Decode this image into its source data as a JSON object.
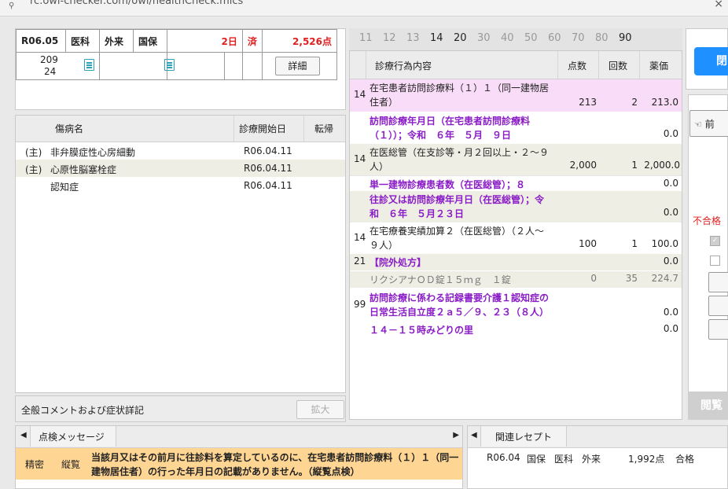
{
  "browser": {
    "url": "rc.owl-checker.com/owl/healthCheck.mics"
  },
  "header": {
    "era_month": "R06.05",
    "dept": "医科",
    "visit_type": "外来",
    "insurance": "国保",
    "days": "2日",
    "status": "済",
    "points": "2,526点",
    "code_top": "209",
    "code_bottom": "24",
    "detail_button": "詳細"
  },
  "disease": {
    "col_name": "傷病名",
    "col_start": "診療開始日",
    "col_outcome": "転帰",
    "rows": [
      {
        "mark": "(主)",
        "name": "非弁膜症性心房細動",
        "start": "R06.04.11"
      },
      {
        "mark": "(主)",
        "name": "心原性脳塞栓症",
        "start": "R06.04.11"
      },
      {
        "mark": "",
        "name": "認知症",
        "start": "R06.04.11"
      }
    ]
  },
  "comment": {
    "label": "全般コメントおよび症状詳記",
    "expand_button": "拡大"
  },
  "day_strip": [
    "11",
    "12",
    "13",
    "14",
    "20",
    "30",
    "40",
    "50",
    "60",
    "70",
    "80",
    "90"
  ],
  "treatment": {
    "col_content": "診療行為内容",
    "col_points": "点数",
    "col_count": "回数",
    "col_price": "薬価",
    "rows": [
      {
        "code": "14",
        "line1": "在宅患者訪問診療料（１）１（同一建物居",
        "line2": "住者）",
        "points": "213",
        "count": "2",
        "price": "213.0"
      },
      {
        "code": "",
        "line1": "訪問診療年月日（在宅患者訪問診療料",
        "line2": "（１））；令和　６年　５月　９日",
        "points": "",
        "count": "",
        "price": "0.0"
      },
      {
        "code": "14",
        "line1": "在医総管（在支診等・月２回以上・２～９",
        "line2": "人）",
        "points": "2,000",
        "count": "1",
        "price": "2,000.0"
      },
      {
        "code": "",
        "line1": "単一建物診療患者数（在医総管）；８",
        "line2": "",
        "points": "",
        "count": "",
        "price": "0.0"
      },
      {
        "code": "",
        "line1": "往診又は訪問診療年月日（在医総管）；令",
        "line2": "和　６年　５月２３日",
        "points": "",
        "count": "",
        "price": "0.0"
      },
      {
        "code": "14",
        "line1": "在宅療養実績加算２（在医総管）（２人～",
        "line2": "９人）",
        "points": "100",
        "count": "1",
        "price": "100.0"
      },
      {
        "code": "21",
        "line1": "【院外処方】",
        "line2": "",
        "points": "",
        "count": "",
        "price": "0.0"
      },
      {
        "code": "",
        "line1": "リクシアナＯＤ錠１５ｍｇ　１錠",
        "line2": "",
        "points": "0",
        "count": "35",
        "price": "224.7"
      },
      {
        "code": "99",
        "line1": "訪問診療に係わる記録書要介護１認知症の",
        "line2": "日常生活自立度２ａ５／９、２３（８人）",
        "points": "",
        "count": "",
        "price": "0.0"
      },
      {
        "code": "",
        "line1": "１４－１５時みどりの里",
        "line2": "",
        "points": "",
        "count": "",
        "price": "0.0"
      }
    ]
  },
  "side": {
    "top_button": "閉",
    "prev_button": "前",
    "fail_label": "不合格",
    "view_button": "閲覧",
    "checked_box": true,
    "unchecked_box": false
  },
  "check_panel": {
    "tab": "点検メッセージ",
    "type": "精密",
    "category": "縦覧",
    "message1": "当該月又はその前月に往診料を算定しているのに、在宅患者訪問診療料（１）１（同一",
    "message2": "建物居住者）の行った年月日の記載がありません。（縦覧点検）"
  },
  "related_panel": {
    "tab": "関連レセプト",
    "row": {
      "month": "R06.04",
      "insurance": "国保",
      "dept": "医科",
      "visit": "外来",
      "points": "1,992点",
      "result": "合格"
    }
  }
}
